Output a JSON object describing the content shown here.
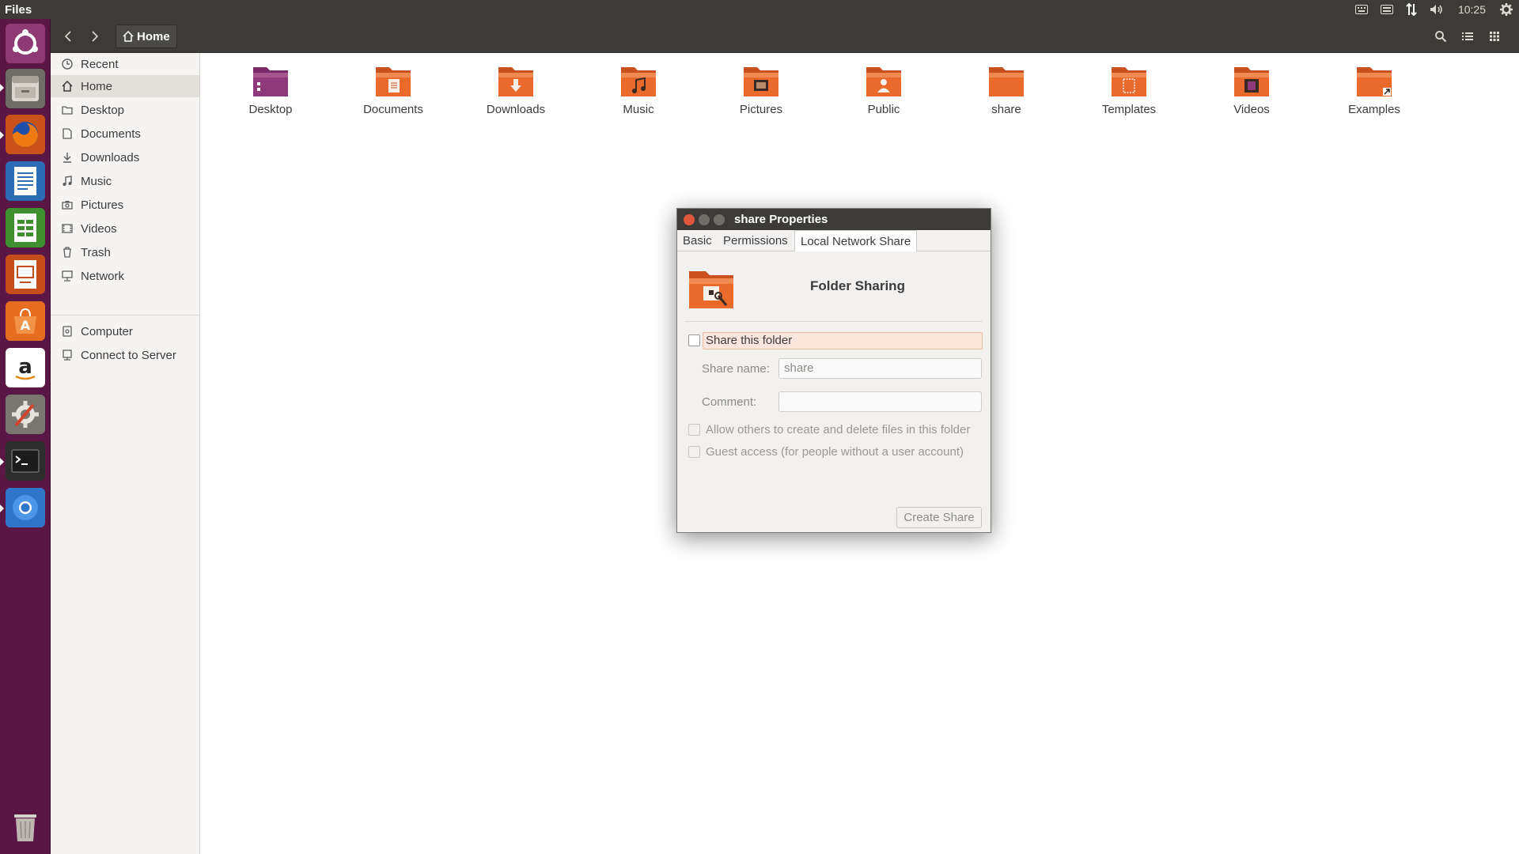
{
  "top_panel": {
    "app_title": "Files",
    "clock": "10:25",
    "indicators": [
      "keyboard-icon",
      "keyboard-layout-icon",
      "network-arrows-icon",
      "volume-icon",
      "gear-icon"
    ]
  },
  "launcher": {
    "items": [
      "ubuntu-dash-icon",
      "files-icon",
      "firefox-icon",
      "writer-icon",
      "calc-icon",
      "impress-icon",
      "software-center-icon",
      "amazon-icon",
      "system-settings-icon",
      "terminal-icon",
      "chromium-icon",
      "trash-icon"
    ]
  },
  "toolbar": {
    "path_home": "Home"
  },
  "sidebar": {
    "items": [
      {
        "label": "Recent",
        "icon": "clock-icon"
      },
      {
        "label": "Home",
        "icon": "home-icon"
      },
      {
        "label": "Desktop",
        "icon": "folder-icon"
      },
      {
        "label": "Documents",
        "icon": "document-icon"
      },
      {
        "label": "Downloads",
        "icon": "download-icon"
      },
      {
        "label": "Music",
        "icon": "music-icon"
      },
      {
        "label": "Pictures",
        "icon": "camera-icon"
      },
      {
        "label": "Videos",
        "icon": "film-icon"
      },
      {
        "label": "Trash",
        "icon": "trash-icon"
      },
      {
        "label": "Network",
        "icon": "network-icon"
      }
    ],
    "devices": [
      {
        "label": "Computer",
        "icon": "computer-icon"
      },
      {
        "label": "Connect to Server",
        "icon": "server-icon"
      }
    ]
  },
  "files": [
    {
      "label": "Desktop",
      "icon": "desktop-folder-icon"
    },
    {
      "label": "Documents",
      "icon": "documents-folder-icon"
    },
    {
      "label": "Downloads",
      "icon": "downloads-folder-icon"
    },
    {
      "label": "Music",
      "icon": "music-folder-icon"
    },
    {
      "label": "Pictures",
      "icon": "pictures-folder-icon"
    },
    {
      "label": "Public",
      "icon": "public-folder-icon"
    },
    {
      "label": "share",
      "icon": "folder-icon"
    },
    {
      "label": "Templates",
      "icon": "templates-folder-icon"
    },
    {
      "label": "Videos",
      "icon": "videos-folder-icon"
    },
    {
      "label": "Examples",
      "icon": "examples-folder-icon"
    }
  ],
  "dialog": {
    "title": "share Properties",
    "tabs": [
      "Basic",
      "Permissions",
      "Local Network Share"
    ],
    "active_tab": "Local Network Share",
    "heading": "Folder Sharing",
    "share_checkbox_label": "Share this folder",
    "share_name_label": "Share name:",
    "share_name_value": "share",
    "comment_label": "Comment:",
    "comment_value": "",
    "allow_others_label": "Allow others to create and delete files in this folder",
    "guest_access_label": "Guest access (for people without a user account)",
    "create_button": "Create Share"
  }
}
